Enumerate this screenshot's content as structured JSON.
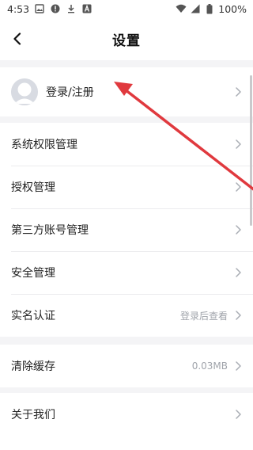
{
  "status_bar": {
    "time": "4:53",
    "battery": "100%",
    "left_icons": [
      "image-icon",
      "alert-icon",
      "download-icon",
      "a-icon"
    ],
    "right_icons": [
      "wifi-icon",
      "signal-icon",
      "battery-icon"
    ]
  },
  "header": {
    "title": "设置",
    "back_icon": "back-chevron-icon"
  },
  "profile": {
    "label": "登录/注册"
  },
  "groups": {
    "permissions": [
      {
        "label": "系统权限管理",
        "value": ""
      },
      {
        "label": "授权管理",
        "value": ""
      },
      {
        "label": "第三方账号管理",
        "value": ""
      },
      {
        "label": "安全管理",
        "value": ""
      },
      {
        "label": "实名认证",
        "value": "登录后查看"
      }
    ],
    "cache": [
      {
        "label": "清除缓存",
        "value": "0.03MB"
      }
    ],
    "about": [
      {
        "label": "关于我们",
        "value": ""
      }
    ]
  },
  "colors": {
    "background": "#f4f4f6",
    "card": "#ffffff",
    "secondary_text": "#a0a4ab",
    "annotation_arrow": "#e0393e"
  }
}
